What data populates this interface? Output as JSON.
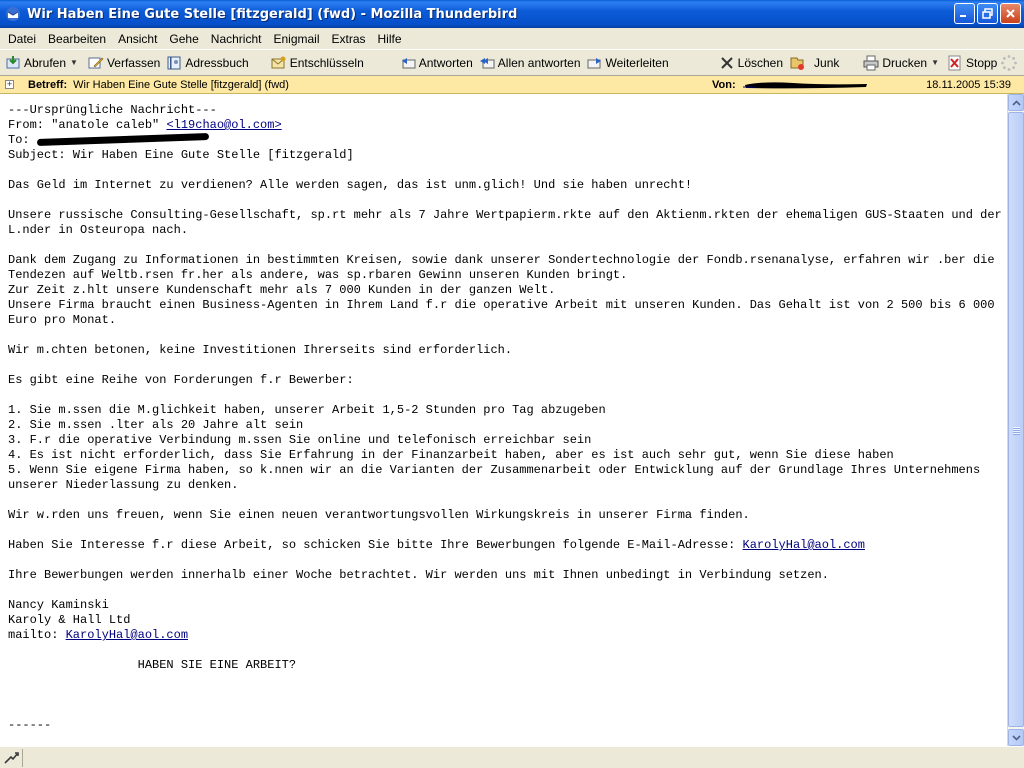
{
  "window": {
    "title": "Wir Haben Eine Gute Stelle [fitzgerald] (fwd) - Mozilla Thunderbird"
  },
  "menu": {
    "items": [
      {
        "first": "D",
        "rest": "atei"
      },
      {
        "first": "B",
        "rest": "earbeiten"
      },
      {
        "first": "A",
        "rest": "nsicht"
      },
      {
        "first": "G",
        "rest": "ehe"
      },
      {
        "first": "N",
        "rest": "achricht"
      },
      {
        "first": "E",
        "rest": "nigmail"
      },
      {
        "first": "E",
        "rest": "xtras",
        "ul_index": 0
      },
      {
        "first": "H",
        "rest": "ilfe"
      }
    ],
    "labels": [
      "Datei",
      "Bearbeiten",
      "Ansicht",
      "Gehe",
      "Nachricht",
      "Enigmail",
      "Extras",
      "Hilfe"
    ]
  },
  "toolbar": {
    "get_mail": "Abrufen",
    "compose": "Verfassen",
    "address_book": "Adressbuch",
    "decrypt": "Entschlüsseln",
    "reply": "Antworten",
    "reply_all": "Allen antworten",
    "forward": "Weiterleiten",
    "delete": "Löschen",
    "junk": "Junk",
    "print": "Drucken",
    "stop": "Stopp"
  },
  "header": {
    "subject_label": "Betreff:",
    "subject": "Wir Haben Eine Gute Stelle [fitzgerald] (fwd)",
    "from_label": "Von:",
    "date": "18.11.2005 15:39"
  },
  "message": {
    "l01": "---Ursprüngliche Nachricht---",
    "l02_prefix": "From: \"anatole caleb\" ",
    "l02_email": "<l19chao@ol.com>",
    "l03_prefix": "To: ",
    "l04": "Subject: Wir Haben Eine Gute Stelle [fitzgerald]",
    "l06": "Das Geld im Internet zu verdienen? Alle werden sagen, das ist unm.glich! Und sie haben unrecht!",
    "l08": "Unsere russische Consulting-Gesellschaft, sp.rt mehr als 7 Jahre Wertpapierm.rkte auf den Aktienm.rkten der ehemaligen GUS-Staaten und der",
    "l09": "L.nder in Osteuropa nach.",
    "l11": "Dank dem Zugang zu Informationen in bestimmten Kreisen, sowie dank unserer Sondertechnologie der Fondb.rsenanalyse, erfahren wir .ber die",
    "l12": "Tendezen auf Weltb.rsen fr.her als andere, was sp.rbaren Gewinn unseren Kunden bringt.",
    "l13": "Zur Zeit z.hlt unsere Kundenschaft mehr als 7 000 Kunden in der ganzen Welt.",
    "l14": "Unsere Firma braucht einen Business-Agenten in Ihrem Land f.r die operative Arbeit mit unseren Kunden. Das Gehalt ist von 2 500 bis 6 000",
    "l15": "Euro pro Monat.",
    "l17": "Wir m.chten betonen, keine Investitionen Ihrerseits sind erforderlich.",
    "l19": "Es gibt eine Reihe von Forderungen f.r Bewerber:",
    "l21": "1. Sie m.ssen die M.glichkeit haben, unserer Arbeit 1,5-2 Stunden pro Tag abzugeben",
    "l22": "2. Sie m.ssen .lter als 20 Jahre alt sein",
    "l23": "3. F.r die operative Verbindung m.ssen Sie online und telefonisch erreichbar sein",
    "l24": "4. Es ist nicht erforderlich, dass Sie Erfahrung in der Finanzarbeit haben, aber es ist auch sehr gut, wenn Sie diese haben",
    "l25": "5. Wenn Sie eigene Firma haben, so k.nnen wir an die Varianten der Zusammenarbeit oder Entwicklung auf der Grundlage Ihres Unternehmens",
    "l26": "unserer Niederlassung zu denken.",
    "l28": "Wir w.rden uns freuen, wenn Sie einen neuen verantwortungsvollen Wirkungskreis in unserer Firma finden.",
    "l30_prefix": "Haben Sie Interesse f.r diese Arbeit, so schicken Sie bitte Ihre Bewerbungen folgende E-Mail-Adresse: ",
    "l30_email": "KarolyHal@aol.com",
    "l32": "Ihre Bewerbungen werden innerhalb einer Woche betrachtet. Wir werden uns mit Ihnen unbedingt in Verbindung setzen.",
    "l34": "Nancy Kaminski",
    "l35": "Karoly & Hall Ltd",
    "l36_prefix": "mailto: ",
    "l36_email": "KarolyHal@aol.com",
    "l38": "                  HABEN SIE EINE ARBEIT?",
    "l42": "------"
  },
  "colors": {
    "titlebar": "#0b5bd8",
    "header_bg": "#fde8a4",
    "link": "#00007f",
    "chrome": "#ece9d8"
  },
  "icons": {
    "app": "thunderbird-icon",
    "minimize": "minimize-icon",
    "maximize": "restore-icon",
    "close": "close-icon"
  }
}
